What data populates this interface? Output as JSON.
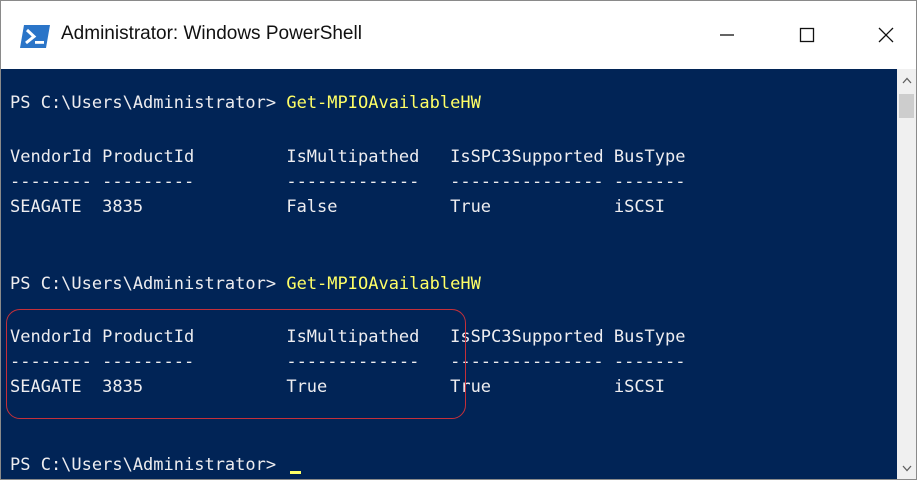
{
  "window": {
    "title": "Administrator: Windows PowerShell",
    "icon": "powershell-icon",
    "controls": [
      "minimize-icon",
      "maximize-icon",
      "close-icon"
    ]
  },
  "colors": {
    "console_bg": "#012456",
    "console_text": "#eeedf0",
    "command_text": "#ffff66",
    "highlight_outline": "#c5303a"
  },
  "console": {
    "blocks": [
      {
        "prompt": "PS C:\\Users\\Administrator> ",
        "command": "Get-MPIOAvailableHW",
        "header": "VendorId ProductId         IsMultipathed   IsSPC3Supported BusType",
        "separator": "-------- ---------         -------------   --------------- -------",
        "row": "SEAGATE  3835              False           True            iSCSI"
      },
      {
        "prompt": "PS C:\\Users\\Administrator> ",
        "command": "Get-MPIOAvailableHW",
        "header": "VendorId ProductId         IsMultipathed   IsSPC3Supported BusType",
        "separator": "-------- ---------         -------------   --------------- -------",
        "row": "SEAGATE  3835              True            True            iSCSI"
      }
    ],
    "final_prompt": "PS C:\\Users\\Administrator> "
  }
}
